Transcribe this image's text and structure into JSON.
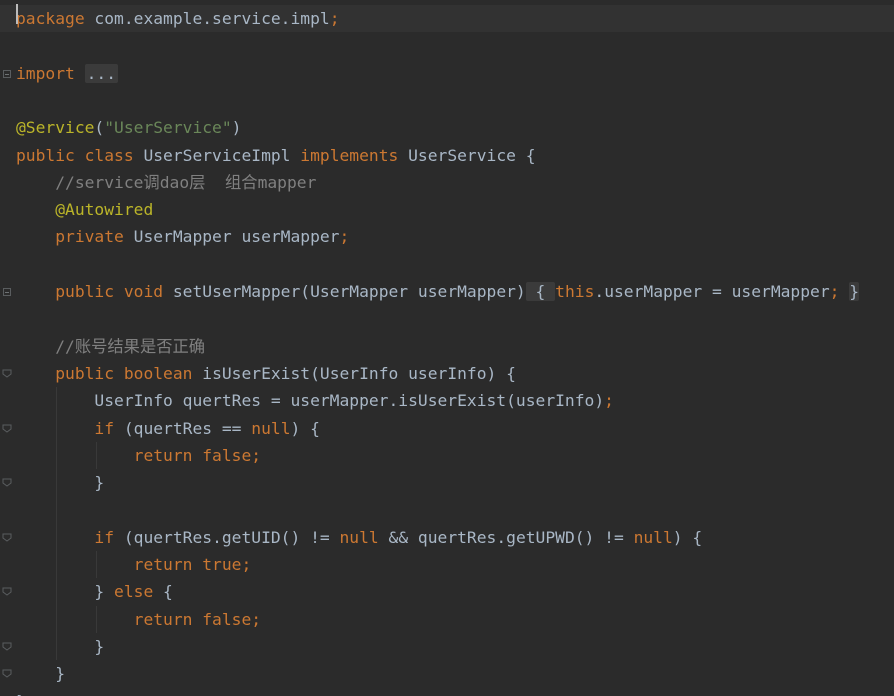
{
  "editor": {
    "lines": [
      {
        "tokens": [
          {
            "t": "package",
            "c": "kw"
          },
          {
            "t": " com.example.service.impl",
            "c": "plain"
          },
          {
            "t": ";",
            "c": "kw"
          }
        ]
      },
      {
        "tokens": []
      },
      {
        "tokens": [
          {
            "t": "import ",
            "c": "kw"
          },
          {
            "t": "...",
            "c": "fold"
          }
        ]
      },
      {
        "tokens": []
      },
      {
        "tokens": [
          {
            "t": "@Service",
            "c": "ann"
          },
          {
            "t": "(",
            "c": "plain"
          },
          {
            "t": "\"UserService\"",
            "c": "str"
          },
          {
            "t": ")",
            "c": "plain"
          }
        ]
      },
      {
        "tokens": [
          {
            "t": "public class ",
            "c": "kw"
          },
          {
            "t": "UserServiceImpl ",
            "c": "plain"
          },
          {
            "t": "implements ",
            "c": "kw"
          },
          {
            "t": "UserService {",
            "c": "plain"
          }
        ]
      },
      {
        "tokens": [
          {
            "t": "    //service调dao层  组合mapper",
            "c": "cmt"
          }
        ]
      },
      {
        "tokens": [
          {
            "t": "    ",
            "c": "plain"
          },
          {
            "t": "@Autowired",
            "c": "ann"
          }
        ]
      },
      {
        "tokens": [
          {
            "t": "    ",
            "c": "plain"
          },
          {
            "t": "private ",
            "c": "kw"
          },
          {
            "t": "UserMapper userMapper",
            "c": "plain"
          },
          {
            "t": ";",
            "c": "kw"
          }
        ]
      },
      {
        "tokens": []
      },
      {
        "tokens": [
          {
            "t": "    ",
            "c": "plain"
          },
          {
            "t": "public void ",
            "c": "kw"
          },
          {
            "t": "setUserMapper(UserMapper userMapper)",
            "c": "plain"
          },
          {
            "t": " { ",
            "c": "brace"
          },
          {
            "t": "this",
            "c": "kw"
          },
          {
            "t": ".userMapper = userMapper",
            "c": "plain"
          },
          {
            "t": "; ",
            "c": "kw"
          },
          {
            "t": "}",
            "c": "brace"
          }
        ]
      },
      {
        "tokens": []
      },
      {
        "tokens": [
          {
            "t": "    //账号结果是否正确",
            "c": "cmt"
          }
        ]
      },
      {
        "tokens": [
          {
            "t": "    ",
            "c": "plain"
          },
          {
            "t": "public boolean ",
            "c": "kw"
          },
          {
            "t": "isUserExist(UserInfo userInfo) {",
            "c": "plain"
          }
        ]
      },
      {
        "tokens": [
          {
            "t": "        UserInfo quertRes = userMapper.isUserExist(userInfo)",
            "c": "plain"
          },
          {
            "t": ";",
            "c": "kw"
          }
        ]
      },
      {
        "tokens": [
          {
            "t": "        ",
            "c": "plain"
          },
          {
            "t": "if ",
            "c": "kw"
          },
          {
            "t": "(quertRes == ",
            "c": "plain"
          },
          {
            "t": "null",
            "c": "kw"
          },
          {
            "t": ") {",
            "c": "plain"
          }
        ]
      },
      {
        "tokens": [
          {
            "t": "            ",
            "c": "plain"
          },
          {
            "t": "return false;",
            "c": "kw"
          }
        ]
      },
      {
        "tokens": [
          {
            "t": "        }",
            "c": "plain"
          }
        ]
      },
      {
        "tokens": []
      },
      {
        "tokens": [
          {
            "t": "        ",
            "c": "plain"
          },
          {
            "t": "if ",
            "c": "kw"
          },
          {
            "t": "(quertRes.getUID() != ",
            "c": "plain"
          },
          {
            "t": "null ",
            "c": "kw"
          },
          {
            "t": "&& quertRes.getUPWD() != ",
            "c": "plain"
          },
          {
            "t": "null",
            "c": "kw"
          },
          {
            "t": ") {",
            "c": "plain"
          }
        ]
      },
      {
        "tokens": [
          {
            "t": "            ",
            "c": "plain"
          },
          {
            "t": "return true;",
            "c": "kw"
          }
        ]
      },
      {
        "tokens": [
          {
            "t": "        } ",
            "c": "plain"
          },
          {
            "t": "else ",
            "c": "kw"
          },
          {
            "t": "{",
            "c": "plain"
          }
        ]
      },
      {
        "tokens": [
          {
            "t": "            ",
            "c": "plain"
          },
          {
            "t": "return false;",
            "c": "kw"
          }
        ]
      },
      {
        "tokens": [
          {
            "t": "        }",
            "c": "plain"
          }
        ]
      },
      {
        "tokens": [
          {
            "t": "    }",
            "c": "plain"
          }
        ]
      },
      {
        "tokens": [
          {
            "t": "}",
            "c": "plain"
          }
        ]
      }
    ]
  },
  "colors": {
    "background": "#2b2b2b",
    "current_line": "#323232",
    "keyword": "#cc7832",
    "string": "#6a8759",
    "annotation": "#bbb529",
    "comment": "#808080",
    "text": "#a9b7c6"
  }
}
